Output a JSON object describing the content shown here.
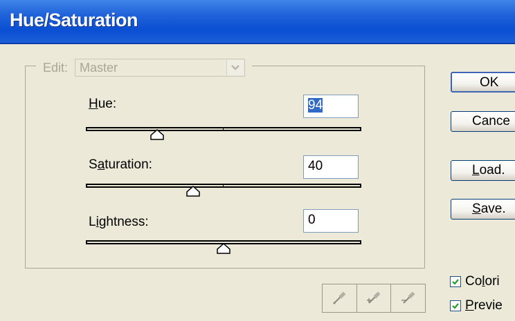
{
  "window": {
    "title": "Hue/Saturation"
  },
  "edit": {
    "label": "Edit:",
    "value": "Master"
  },
  "hue": {
    "label_pre": "",
    "label_u": "H",
    "label_post": "ue:",
    "value": "94",
    "slider_position": 0.26
  },
  "saturation": {
    "label_pre": "S",
    "label_u": "a",
    "label_post": "turation:",
    "value": "40",
    "slider_position": 0.39
  },
  "lightness": {
    "label_pre": "L",
    "label_u": "i",
    "label_post": "ghtness:",
    "value": "0",
    "slider_position": 0.5
  },
  "buttons": {
    "ok": "OK",
    "cancel": "Cance",
    "load_u": "L",
    "load_rest": "oad.",
    "save_u": "S",
    "save_rest": "ave."
  },
  "checkboxes": {
    "colorize_pre": "Co",
    "colorize_u": "l",
    "colorize_post": "ori",
    "colorize_checked": true,
    "preview_u": "P",
    "preview_post": "revie",
    "preview_checked": true
  },
  "icons": [
    "chevron-down-icon",
    "eyedropper-icon",
    "eyedropper-plus-icon",
    "eyedropper-minus-icon",
    "checkmark-icon"
  ],
  "colors": {
    "titlebar": "#0a4ed2",
    "dialog": "#ece9d8",
    "selection": "#316ac5"
  }
}
